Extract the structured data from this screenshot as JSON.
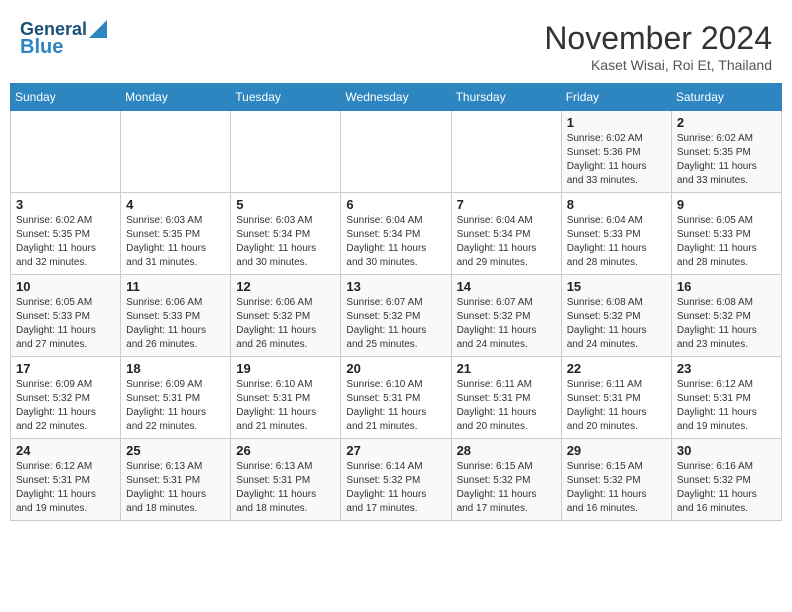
{
  "header": {
    "logo_line1": "General",
    "logo_line2": "Blue",
    "month": "November 2024",
    "location": "Kaset Wisai, Roi Et, Thailand"
  },
  "days_of_week": [
    "Sunday",
    "Monday",
    "Tuesday",
    "Wednesday",
    "Thursday",
    "Friday",
    "Saturday"
  ],
  "weeks": [
    [
      {
        "day": "",
        "info": ""
      },
      {
        "day": "",
        "info": ""
      },
      {
        "day": "",
        "info": ""
      },
      {
        "day": "",
        "info": ""
      },
      {
        "day": "",
        "info": ""
      },
      {
        "day": "1",
        "info": "Sunrise: 6:02 AM\nSunset: 5:36 PM\nDaylight: 11 hours\nand 33 minutes."
      },
      {
        "day": "2",
        "info": "Sunrise: 6:02 AM\nSunset: 5:35 PM\nDaylight: 11 hours\nand 33 minutes."
      }
    ],
    [
      {
        "day": "3",
        "info": "Sunrise: 6:02 AM\nSunset: 5:35 PM\nDaylight: 11 hours\nand 32 minutes."
      },
      {
        "day": "4",
        "info": "Sunrise: 6:03 AM\nSunset: 5:35 PM\nDaylight: 11 hours\nand 31 minutes."
      },
      {
        "day": "5",
        "info": "Sunrise: 6:03 AM\nSunset: 5:34 PM\nDaylight: 11 hours\nand 30 minutes."
      },
      {
        "day": "6",
        "info": "Sunrise: 6:04 AM\nSunset: 5:34 PM\nDaylight: 11 hours\nand 30 minutes."
      },
      {
        "day": "7",
        "info": "Sunrise: 6:04 AM\nSunset: 5:34 PM\nDaylight: 11 hours\nand 29 minutes."
      },
      {
        "day": "8",
        "info": "Sunrise: 6:04 AM\nSunset: 5:33 PM\nDaylight: 11 hours\nand 28 minutes."
      },
      {
        "day": "9",
        "info": "Sunrise: 6:05 AM\nSunset: 5:33 PM\nDaylight: 11 hours\nand 28 minutes."
      }
    ],
    [
      {
        "day": "10",
        "info": "Sunrise: 6:05 AM\nSunset: 5:33 PM\nDaylight: 11 hours\nand 27 minutes."
      },
      {
        "day": "11",
        "info": "Sunrise: 6:06 AM\nSunset: 5:33 PM\nDaylight: 11 hours\nand 26 minutes."
      },
      {
        "day": "12",
        "info": "Sunrise: 6:06 AM\nSunset: 5:32 PM\nDaylight: 11 hours\nand 26 minutes."
      },
      {
        "day": "13",
        "info": "Sunrise: 6:07 AM\nSunset: 5:32 PM\nDaylight: 11 hours\nand 25 minutes."
      },
      {
        "day": "14",
        "info": "Sunrise: 6:07 AM\nSunset: 5:32 PM\nDaylight: 11 hours\nand 24 minutes."
      },
      {
        "day": "15",
        "info": "Sunrise: 6:08 AM\nSunset: 5:32 PM\nDaylight: 11 hours\nand 24 minutes."
      },
      {
        "day": "16",
        "info": "Sunrise: 6:08 AM\nSunset: 5:32 PM\nDaylight: 11 hours\nand 23 minutes."
      }
    ],
    [
      {
        "day": "17",
        "info": "Sunrise: 6:09 AM\nSunset: 5:32 PM\nDaylight: 11 hours\nand 22 minutes."
      },
      {
        "day": "18",
        "info": "Sunrise: 6:09 AM\nSunset: 5:31 PM\nDaylight: 11 hours\nand 22 minutes."
      },
      {
        "day": "19",
        "info": "Sunrise: 6:10 AM\nSunset: 5:31 PM\nDaylight: 11 hours\nand 21 minutes."
      },
      {
        "day": "20",
        "info": "Sunrise: 6:10 AM\nSunset: 5:31 PM\nDaylight: 11 hours\nand 21 minutes."
      },
      {
        "day": "21",
        "info": "Sunrise: 6:11 AM\nSunset: 5:31 PM\nDaylight: 11 hours\nand 20 minutes."
      },
      {
        "day": "22",
        "info": "Sunrise: 6:11 AM\nSunset: 5:31 PM\nDaylight: 11 hours\nand 20 minutes."
      },
      {
        "day": "23",
        "info": "Sunrise: 6:12 AM\nSunset: 5:31 PM\nDaylight: 11 hours\nand 19 minutes."
      }
    ],
    [
      {
        "day": "24",
        "info": "Sunrise: 6:12 AM\nSunset: 5:31 PM\nDaylight: 11 hours\nand 19 minutes."
      },
      {
        "day": "25",
        "info": "Sunrise: 6:13 AM\nSunset: 5:31 PM\nDaylight: 11 hours\nand 18 minutes."
      },
      {
        "day": "26",
        "info": "Sunrise: 6:13 AM\nSunset: 5:31 PM\nDaylight: 11 hours\nand 18 minutes."
      },
      {
        "day": "27",
        "info": "Sunrise: 6:14 AM\nSunset: 5:32 PM\nDaylight: 11 hours\nand 17 minutes."
      },
      {
        "day": "28",
        "info": "Sunrise: 6:15 AM\nSunset: 5:32 PM\nDaylight: 11 hours\nand 17 minutes."
      },
      {
        "day": "29",
        "info": "Sunrise: 6:15 AM\nSunset: 5:32 PM\nDaylight: 11 hours\nand 16 minutes."
      },
      {
        "day": "30",
        "info": "Sunrise: 6:16 AM\nSunset: 5:32 PM\nDaylight: 11 hours\nand 16 minutes."
      }
    ]
  ]
}
